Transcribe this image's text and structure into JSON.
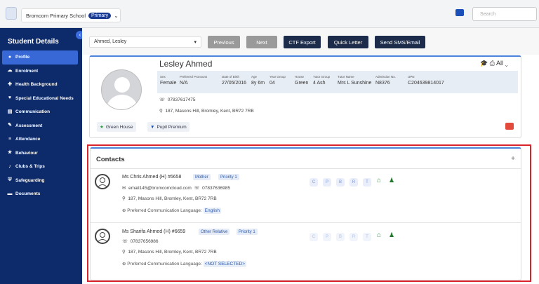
{
  "topbar": {
    "school": "Bromcom Primary School",
    "badge": "Primary",
    "search_placeholder": "Search"
  },
  "sidebar": {
    "title": "Student Details",
    "items": [
      {
        "label": "Profile",
        "icon": "profile-icon",
        "active": true
      },
      {
        "label": "Enrolment",
        "icon": "cloud-icon"
      },
      {
        "label": "Health Background",
        "icon": "health-icon"
      },
      {
        "label": "Special Educational Needs",
        "icon": "heart-icon"
      },
      {
        "label": "Communication",
        "icon": "message-icon"
      },
      {
        "label": "Assessment",
        "icon": "pencil-icon"
      },
      {
        "label": "Attendance",
        "icon": "list-icon"
      },
      {
        "label": "Behaviour",
        "icon": "star-icon"
      },
      {
        "label": "Clubs & Trips",
        "icon": "music-icon"
      },
      {
        "label": "Safeguarding",
        "icon": "shield-icon"
      },
      {
        "label": "Documents",
        "icon": "folder-icon"
      }
    ]
  },
  "toolbar": {
    "student": "Ahmed, Lesley",
    "previous": "Previous",
    "next": "Next",
    "ctf": "CTF Export",
    "quick": "Quick Letter",
    "sms": "Send SMS/Email"
  },
  "profile": {
    "name": "Lesley Ahmed",
    "all_label": "All",
    "fields": [
      {
        "label": "Sex",
        "value": "Female"
      },
      {
        "label": "Preferred Pronouns",
        "value": "N/A"
      },
      {
        "label": "Date of Birth",
        "value": "27/05/2016"
      },
      {
        "label": "Age",
        "value": "8y 6m"
      },
      {
        "label": "Year Group",
        "value": "04"
      },
      {
        "label": "House",
        "value": "Green"
      },
      {
        "label": "Tutor Group",
        "value": "4 Ash"
      },
      {
        "label": "Tutor Name",
        "value": "Mrs L Sunshine"
      },
      {
        "label": "Admission No.",
        "value": "N8376"
      },
      {
        "label": "UPN",
        "value": "C204639814017"
      }
    ],
    "phone": "07837617475",
    "address": "187, Masons Hill, Bromley, Kent, BR72 7RB",
    "tags": [
      "Green House",
      "Pupil Premium"
    ]
  },
  "contacts": {
    "title": "Contacts",
    "pref_label": "Preferred Communication Language:",
    "list": [
      {
        "name": "Ms Chris Ahmed (H) #6658",
        "relation": "Mother",
        "priority": "Priority 1",
        "email": "email145@bromcomcloud.com",
        "phone": "07837636985",
        "address": "187, Masons Hill, Bromley, Kent, BR72 7RB",
        "language": "English",
        "channels": [
          "C",
          "P",
          "B",
          "R",
          "T"
        ]
      },
      {
        "name": "Ms Sharifa Ahmed (H) #6659",
        "relation": "Other Relative",
        "priority": "Priority 1",
        "phone": "07837656986",
        "address": "187, Masons Hill, Bromley, Kent, BR72 7RB",
        "language": "<NOT SELECTED>",
        "channels": [
          "C",
          "P",
          "B",
          "R",
          "T"
        ]
      }
    ]
  }
}
